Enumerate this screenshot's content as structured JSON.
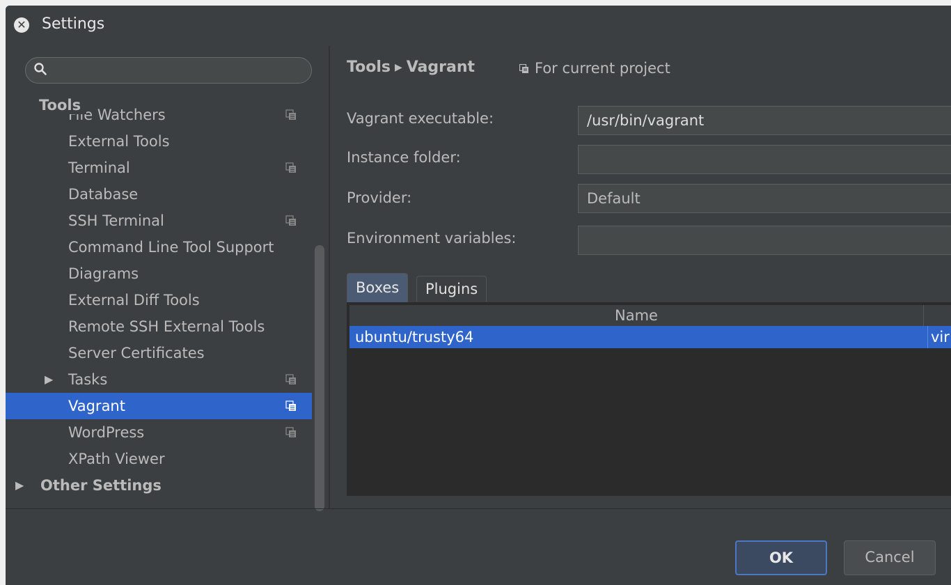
{
  "window": {
    "title": "Settings"
  },
  "search": {
    "placeholder": "",
    "value": ""
  },
  "tree": {
    "header": "Tools",
    "items": [
      {
        "label": "File Watchers",
        "project_icon": true
      },
      {
        "label": "External Tools",
        "project_icon": false
      },
      {
        "label": "Terminal",
        "project_icon": true
      },
      {
        "label": "Database",
        "project_icon": false
      },
      {
        "label": "SSH Terminal",
        "project_icon": true
      },
      {
        "label": "Command Line Tool Support",
        "project_icon": false
      },
      {
        "label": "Diagrams",
        "project_icon": false
      },
      {
        "label": "External Diff Tools",
        "project_icon": false
      },
      {
        "label": "Remote SSH External Tools",
        "project_icon": false
      },
      {
        "label": "Server Certificates",
        "project_icon": false
      },
      {
        "label": "Tasks",
        "project_icon": true,
        "expandable": true
      },
      {
        "label": "Vagrant",
        "project_icon": true,
        "selected": true
      },
      {
        "label": "WordPress",
        "project_icon": true
      },
      {
        "label": "XPath Viewer",
        "project_icon": false
      }
    ],
    "other_group": "Other Settings"
  },
  "breadcrumb": {
    "parent": "Tools",
    "current": "Vagrant"
  },
  "scope": {
    "label": "For current project"
  },
  "form": {
    "executable": {
      "label": "Vagrant executable:",
      "value": "/usr/bin/vagrant"
    },
    "instance_folder": {
      "label": "Instance folder:",
      "value": ""
    },
    "provider": {
      "label": "Provider:",
      "value": "Default"
    },
    "env_vars": {
      "label": "Environment variables:",
      "value": ""
    }
  },
  "tabs": {
    "boxes": "Boxes",
    "plugins": "Plugins"
  },
  "boxes_table": {
    "columns": [
      "Name"
    ],
    "rows": [
      {
        "name": "ubuntu/trusty64",
        "provider": "vir"
      }
    ]
  },
  "buttons": {
    "ok": "OK",
    "cancel": "Cancel"
  },
  "colors": {
    "accent": "#2f65ca",
    "background": "#3c3f41",
    "text": "#bbbbbb"
  }
}
